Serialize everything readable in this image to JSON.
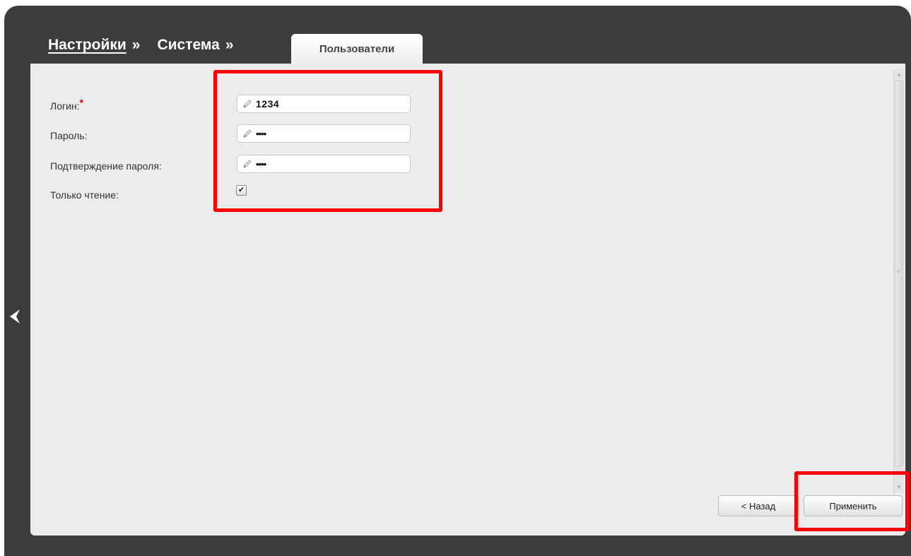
{
  "breadcrumb": {
    "settings": "Настройки",
    "settings_sep": "»",
    "system": "Система",
    "system_sep": "»"
  },
  "tab": {
    "active_label": "Пользователи"
  },
  "form": {
    "login_label": "Логин:",
    "login_required_mark": "*",
    "login_value": "1234",
    "password_label": "Пароль:",
    "password_value": "••••",
    "confirm_label": "Подтверждение пароля:",
    "confirm_value": "••••",
    "readonly_label": "Только чтение:",
    "readonly_checked": true,
    "readonly_check_glyph": "✔"
  },
  "buttons": {
    "back_label": "< Назад",
    "apply_label": "Применить"
  },
  "icons": {
    "edit_icon": "pencil-icon",
    "nav_back_icon": "arrow-left-icon",
    "checkmark_icon": "checkmark-icon"
  },
  "colors": {
    "frame_bg": "#3c3c3c",
    "content_bg": "#ececec",
    "highlight": "#ff0000",
    "required": "#e00000"
  }
}
